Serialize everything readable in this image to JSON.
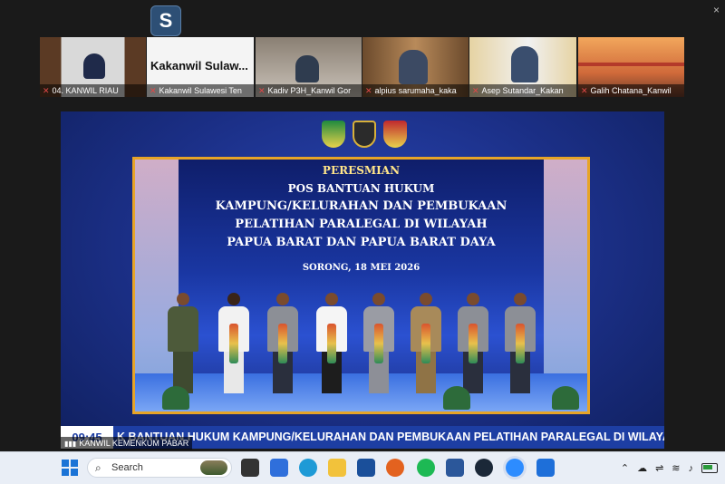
{
  "app": {
    "logo_letter": "S",
    "close_glyph": "×"
  },
  "participants": [
    {
      "name": "04. KANWIL RIAU",
      "muted": true
    },
    {
      "name": "Kakanwil Sulawesi Ten",
      "muted": true,
      "display_text": "Kakanwil  Sulaw..."
    },
    {
      "name": "Kadiv P3H_Kanwil Gor",
      "muted": true
    },
    {
      "name": "alpius sarumaha_kaka",
      "muted": true
    },
    {
      "name": "Asep Sutandar_Kakan",
      "muted": true
    },
    {
      "name": "Galih Chatana_Kanwil",
      "muted": true
    }
  ],
  "banner": {
    "line1": "PERESMIAN",
    "line2": "POS BANTUAN HUKUM",
    "line3": "KAMPUNG/KELURAHAN DAN PEMBUKAAN",
    "line4": "PELATIHAN PARALEGAL DI WILAYAH",
    "line5": "PAPUA BARAT DAN PAPUA BARAT DAYA",
    "date": "SORONG, 18 MEI 2026"
  },
  "ticker": {
    "clock": "09:45",
    "text": "K BANTUAN HUKUM KAMPUNG/KELURAHAN  DAN PEMBUKAAN PELATIHAN PARALEGAL DI WILAYAH"
  },
  "active_speaker": "KANWIL KEMENKUM PABAR",
  "taskbar": {
    "search_label": "Search",
    "tray_icons": [
      "chevron-up-icon",
      "cloud-icon",
      "network-icon",
      "wifi-icon",
      "volume-icon",
      "battery-icon"
    ]
  },
  "colors": {
    "stage_bg": "#1b2f86",
    "screen_border": "#e7a427",
    "ticker_bg": "#1d3ea3",
    "muted_mic": "#e04848"
  }
}
